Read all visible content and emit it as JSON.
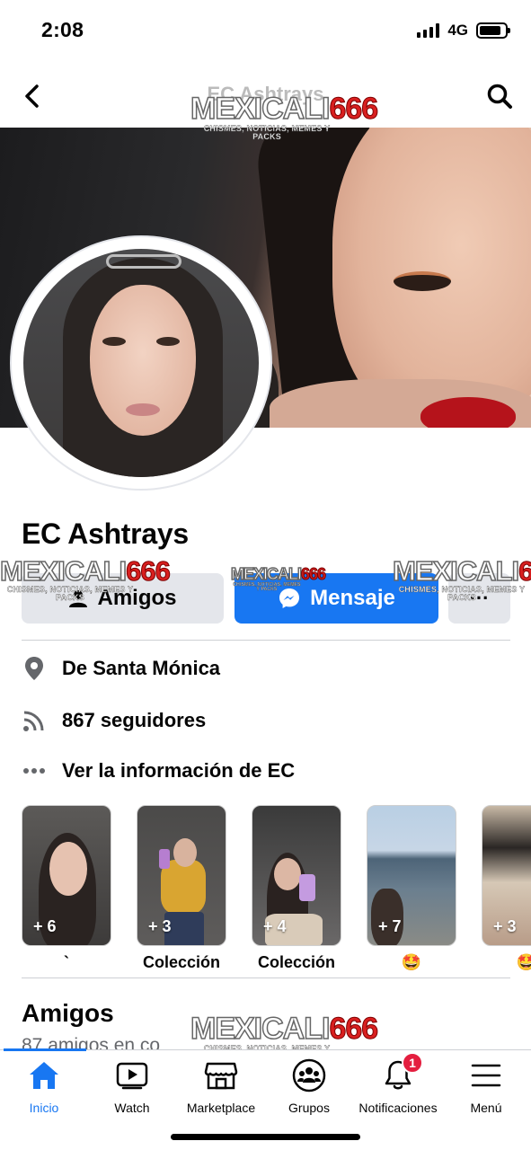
{
  "status_bar": {
    "time": "2:08",
    "network": "4G",
    "battery_level": 0.85
  },
  "header": {
    "title": "EC Ashtrays",
    "back_icon": "chevron-left-icon",
    "search_icon": "search-icon"
  },
  "watermark": {
    "brand_a": "MEXICALI",
    "brand_b": "666",
    "tagline": "CHISMES, NOTICIAS, MEMES Y PACKS"
  },
  "profile": {
    "name": "EC Ashtrays"
  },
  "actions": {
    "friends_label": "Amigos",
    "message_label": "Mensaje",
    "more_label": "···"
  },
  "info": {
    "location": "De Santa Mónica",
    "followers": "867 seguidores",
    "about": "Ver la información de EC"
  },
  "highlights": [
    {
      "count": "+ 6",
      "label": "`"
    },
    {
      "count": "+ 3",
      "label": "Colección"
    },
    {
      "count": "+ 4",
      "label": "Colección"
    },
    {
      "count": "+ 7",
      "label": "🤩"
    },
    {
      "count": "+ 3",
      "label": "🤩"
    }
  ],
  "friends_section": {
    "title": "Amigos",
    "subtitle": "87 amigos en co"
  },
  "bottom_nav": [
    {
      "label": "Inicio",
      "icon": "home-icon",
      "active": true
    },
    {
      "label": "Watch",
      "icon": "watch-icon",
      "active": false
    },
    {
      "label": "Marketplace",
      "icon": "marketplace-icon",
      "active": false
    },
    {
      "label": "Grupos",
      "icon": "groups-icon",
      "active": false
    },
    {
      "label": "Notificaciones",
      "icon": "bell-icon",
      "active": false,
      "badge": "1"
    },
    {
      "label": "Menú",
      "icon": "menu-icon",
      "active": false
    }
  ],
  "colors": {
    "accent": "#1877f2",
    "badge": "#e41e3f",
    "button_gray": "#e4e6eb",
    "text": "#050505",
    "secondary_text": "#65676b"
  }
}
